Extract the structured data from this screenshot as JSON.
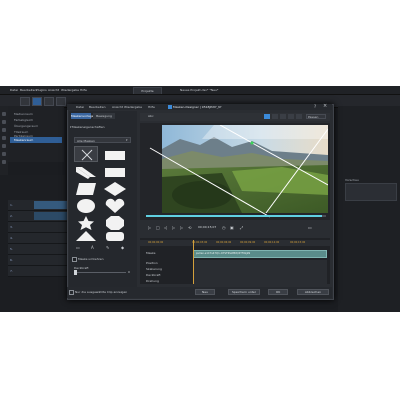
{
  "app": {
    "menu": [
      "Datei",
      "Bearbeiten",
      "Plugins",
      "Ansicht",
      "Wiedergabe",
      "Hilfe"
    ],
    "project_tab": "Projekte",
    "title": "Neues Projekt.dsv* *Neu*",
    "sidebar_items": [
      "Medienraum",
      "Farbabgleich",
      "Übergangsraum",
      "Titelraum",
      "Partikelraum",
      "Maskenraum"
    ],
    "track_numbers": [
      "1.",
      "2.",
      "3.",
      "4.",
      "5.",
      "6.",
      "7."
    ],
    "right_preview_label": "Vorschau"
  },
  "dialog": {
    "title": "Masken-Designer | 9518JP2IY_tif",
    "help": "?",
    "close": "×",
    "menu": [
      "Datei",
      "Bearbeiten",
      "Ansicht",
      "Wiedergabe",
      "Hilfe"
    ],
    "tabs": {
      "templates": "Maskenvorlagen",
      "motion": "Bewegung"
    },
    "section_header": "Maskeneigenschaften",
    "filter_value": "Alle Masken",
    "invert_mask_label": "Maske umkehren",
    "opacity_label": "Deckkraft",
    "opacity_value": "0",
    "toolbar_label": "Abc",
    "zoom_value": "Passen",
    "timecode": "00;00;15;07",
    "ruler_labels": [
      "00;00;00;00",
      "00;00;03;00",
      "00;00;06;00",
      "00;00;09;00",
      "00;00;12;00",
      "00;00;15;00"
    ],
    "keyframe_row_name": "Maske",
    "clip_name": "pullen-s1C7s47Q1-O7ST6SW8W/4T5WjkN",
    "property_labels": [
      "Position",
      "Skalierung",
      "Deckkraft",
      "Drehung"
    ],
    "footer_checkbox_label": "Nur die ausgewählte Clip anzeigen",
    "footer_buttons": [
      "Neu",
      "Speichern unter",
      "OK",
      "Abbrechen"
    ]
  },
  "colors": {
    "accent": "#3b8ad9",
    "selection": "#2f5e96",
    "clip": "#5a8c8a",
    "ruler_text": "#d4a03c"
  }
}
